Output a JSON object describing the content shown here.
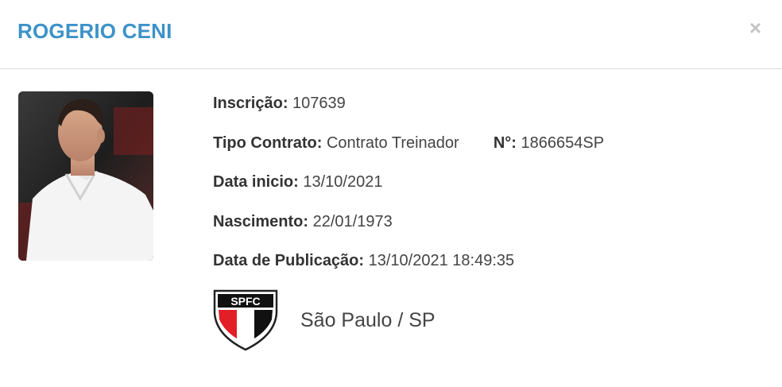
{
  "modal": {
    "title": "ROGERIO CENI",
    "close_label": "×"
  },
  "details": {
    "inscricao": {
      "label": "Inscrição:",
      "value": "107639"
    },
    "tipo_contrato": {
      "label": "Tipo Contrato:",
      "value": "Contrato Treinador"
    },
    "numero": {
      "label": "N°:",
      "value": "1866654SP"
    },
    "data_inicio": {
      "label": "Data inicio:",
      "value": "13/10/2021"
    },
    "nascimento": {
      "label": "Nascimento:",
      "value": "22/01/1973"
    },
    "data_publicacao": {
      "label": "Data de Publicação:",
      "value": "13/10/2021 18:49:35"
    }
  },
  "club": {
    "crest_text": "SPFC",
    "name": "São Paulo / SP"
  },
  "colors": {
    "title": "#3c92c9",
    "crest_red": "#e21f26",
    "crest_black": "#111111"
  },
  "icons": {
    "close": "close-icon",
    "crest": "spfc-crest-icon"
  }
}
